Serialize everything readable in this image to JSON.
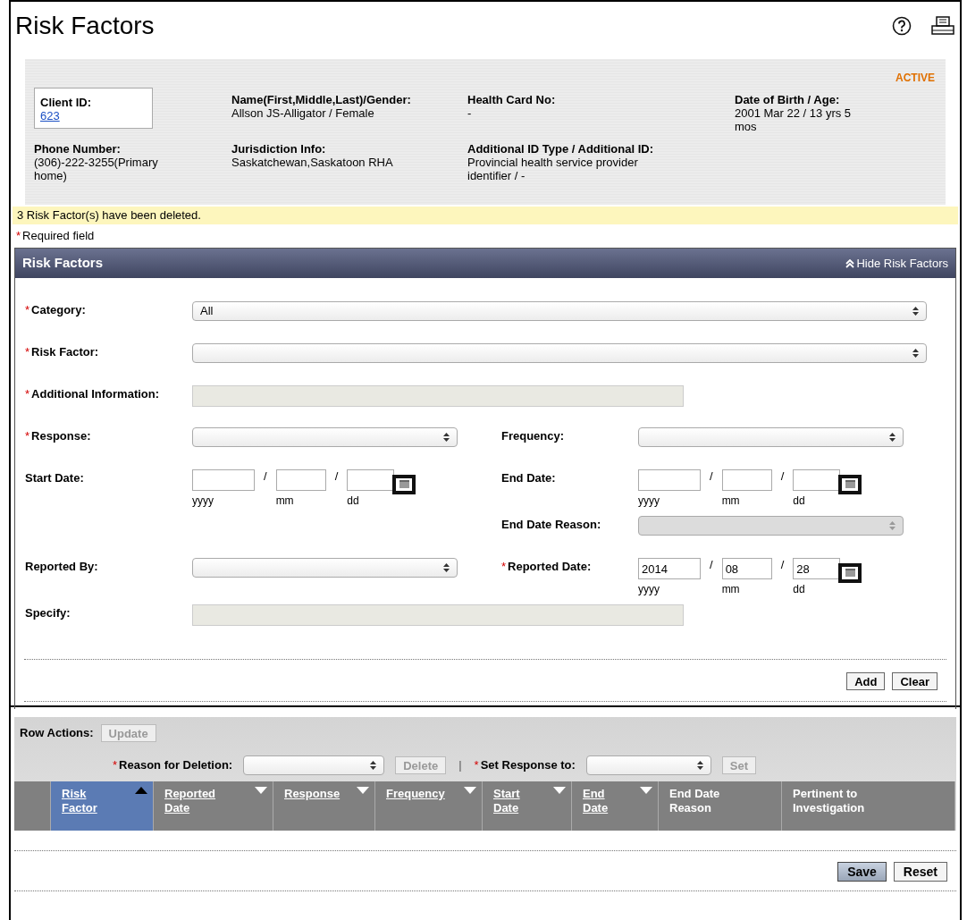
{
  "page": {
    "title": "Risk Factors"
  },
  "required_mark": "*",
  "client": {
    "status": "ACTIVE",
    "fields": [
      {
        "label": "Client ID:",
        "value": "623",
        "kind": "link"
      },
      {
        "label": "Name(First,Middle,Last)/Gender:",
        "value": "Allson JS-Alligator / Female",
        "kind": "text"
      },
      {
        "label": "Health Card No:",
        "value": "-",
        "kind": "text"
      },
      {
        "label": "Date of Birth / Age:",
        "value": "2001 Mar 22 / 13 yrs 5 mos",
        "kind": "text"
      },
      {
        "label": "Phone Number:",
        "value": "(306)-222-3255(Primary home)",
        "kind": "text"
      },
      {
        "label": "Jurisdiction Info:",
        "value": "Saskatchewan,Saskatoon RHA",
        "kind": "text"
      },
      {
        "label": "Additional ID Type / Additional ID:",
        "value": "Provincial health service provider identifier / -",
        "kind": "text"
      }
    ]
  },
  "message": "3 Risk Factor(s) have been deleted.",
  "required_note": "Required field",
  "section": {
    "title": "Risk Factors",
    "toggle": "Hide Risk Factors",
    "expanded": true
  },
  "form_rows": [
    {
      "left": {
        "label": "Category:",
        "required": true,
        "kind": "select",
        "value": "All",
        "disabled": false
      }
    },
    {
      "left": {
        "label": "Risk Factor:",
        "required": true,
        "kind": "select",
        "disabled": false
      }
    },
    {
      "left": {
        "label": "Additional Information:",
        "required": true,
        "kind": "text",
        "disabled": true
      }
    },
    {
      "left": {
        "label": "Response:",
        "required": true,
        "kind": "select",
        "disabled": false
      },
      "right": {
        "label": "Frequency:",
        "required": false,
        "kind": "select",
        "disabled": false
      }
    },
    {
      "left": {
        "label": "Start Date:",
        "required": false,
        "kind": "date",
        "separator": "/",
        "parts": [
          {
            "hint": "yyyy"
          },
          {
            "hint": "mm"
          },
          {
            "hint": "dd"
          }
        ]
      },
      "right": {
        "label": "End Date:",
        "required": false,
        "kind": "date",
        "separator": "/",
        "parts": [
          {
            "hint": "yyyy"
          },
          {
            "hint": "mm"
          },
          {
            "hint": "dd"
          }
        ]
      }
    },
    {
      "right": {
        "label": "End Date Reason:",
        "required": false,
        "kind": "select",
        "disabled": true
      }
    },
    {
      "left": {
        "label": "Reported By:",
        "required": false,
        "kind": "select",
        "disabled": false
      },
      "right": {
        "label": "Reported Date:",
        "required": true,
        "kind": "date",
        "separator": "/",
        "parts": [
          {
            "value": "2014",
            "hint": "yyyy"
          },
          {
            "value": "08",
            "hint": "mm"
          },
          {
            "value": "28",
            "hint": "dd"
          }
        ]
      }
    },
    {
      "left": {
        "label": "Specify:",
        "required": false,
        "kind": "text",
        "disabled": true
      }
    }
  ],
  "form_buttons": [
    {
      "label": "Add",
      "disabled": false
    },
    {
      "label": "Clear",
      "disabled": false
    }
  ],
  "row_actions": {
    "label": "Row Actions:",
    "update": {
      "label": "Update",
      "disabled": true
    },
    "reason": {
      "label": "Reason for Deletion:",
      "required": true
    },
    "delete": {
      "label": "Delete",
      "disabled": true
    },
    "divider": "|",
    "set_response": {
      "label": "Set Response to:",
      "required": true
    },
    "set": {
      "label": "Set",
      "disabled": true
    }
  },
  "table": {
    "columns": [
      {
        "label": "Risk Factor",
        "link": true,
        "kind": "ascending",
        "selected": true
      },
      {
        "label": "Reported Date",
        "link": true,
        "kind": "descending",
        "selected": false
      },
      {
        "label": "Response",
        "link": true,
        "kind": "descending",
        "selected": false
      },
      {
        "label": "Frequency",
        "link": true,
        "kind": "descending",
        "selected": false
      },
      {
        "label": "Start Date",
        "link": true,
        "kind": "descending",
        "selected": false
      },
      {
        "label": "End Date",
        "link": true,
        "kind": "descending",
        "selected": false
      },
      {
        "label": "End Date Reason",
        "link": false,
        "kind": "plain",
        "selected": false
      },
      {
        "label": "Pertinent to Investigation",
        "link": false,
        "kind": "plain",
        "selected": false
      }
    ]
  },
  "footer_buttons": [
    {
      "label": "Save",
      "primary": true
    },
    {
      "label": "Reset",
      "primary": false
    }
  ]
}
